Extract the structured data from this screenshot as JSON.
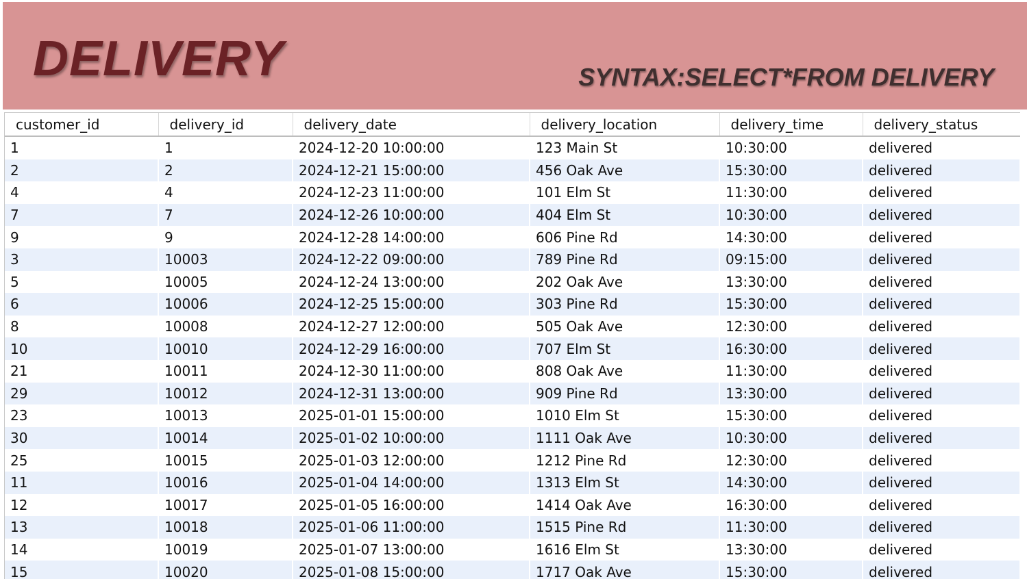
{
  "header": {
    "title": "DELIVERY",
    "syntax": "SYNTAX:SELECT*FROM DELIVERY"
  },
  "colors": {
    "banner": "#d89494",
    "title": "#6b2226",
    "row_stripe": "#e9f0fb"
  },
  "table": {
    "columns": [
      "customer_id",
      "delivery_id",
      "delivery_date",
      "delivery_location",
      "delivery_time",
      "delivery_status"
    ],
    "rows": [
      [
        "1",
        "1",
        "2024-12-20 10:00:00",
        "123 Main St",
        "10:30:00",
        "delivered"
      ],
      [
        "2",
        "2",
        "2024-12-21 15:00:00",
        "456 Oak Ave",
        "15:30:00",
        "delivered"
      ],
      [
        "4",
        "4",
        "2024-12-23 11:00:00",
        "101 Elm St",
        "11:30:00",
        "delivered"
      ],
      [
        "7",
        "7",
        "2024-12-26 10:00:00",
        "404 Elm St",
        "10:30:00",
        "delivered"
      ],
      [
        "9",
        "9",
        "2024-12-28 14:00:00",
        "606 Pine Rd",
        "14:30:00",
        "delivered"
      ],
      [
        "3",
        "10003",
        "2024-12-22 09:00:00",
        "789 Pine Rd",
        "09:15:00",
        "delivered"
      ],
      [
        "5",
        "10005",
        "2024-12-24 13:00:00",
        "202 Oak Ave",
        "13:30:00",
        "delivered"
      ],
      [
        "6",
        "10006",
        "2024-12-25 15:00:00",
        "303 Pine Rd",
        "15:30:00",
        "delivered"
      ],
      [
        "8",
        "10008",
        "2024-12-27 12:00:00",
        "505 Oak Ave",
        "12:30:00",
        "delivered"
      ],
      [
        "10",
        "10010",
        "2024-12-29 16:00:00",
        "707 Elm St",
        "16:30:00",
        "delivered"
      ],
      [
        "21",
        "10011",
        "2024-12-30 11:00:00",
        "808 Oak Ave",
        "11:30:00",
        "delivered"
      ],
      [
        "29",
        "10012",
        "2024-12-31 13:00:00",
        "909 Pine Rd",
        "13:30:00",
        "delivered"
      ],
      [
        "23",
        "10013",
        "2025-01-01 15:00:00",
        "1010 Elm St",
        "15:30:00",
        "delivered"
      ],
      [
        "30",
        "10014",
        "2025-01-02 10:00:00",
        "1111 Oak Ave",
        "10:30:00",
        "delivered"
      ],
      [
        "25",
        "10015",
        "2025-01-03 12:00:00",
        "1212 Pine Rd",
        "12:30:00",
        "delivered"
      ],
      [
        "11",
        "10016",
        "2025-01-04 14:00:00",
        "1313 Elm St",
        "14:30:00",
        "delivered"
      ],
      [
        "12",
        "10017",
        "2025-01-05 16:00:00",
        "1414 Oak Ave",
        "16:30:00",
        "delivered"
      ],
      [
        "13",
        "10018",
        "2025-01-06 11:00:00",
        "1515 Pine Rd",
        "11:30:00",
        "delivered"
      ],
      [
        "14",
        "10019",
        "2025-01-07 13:00:00",
        "1616 Elm St",
        "13:30:00",
        "delivered"
      ],
      [
        "15",
        "10020",
        "2025-01-08 15:00:00",
        "1717 Oak Ave",
        "15:30:00",
        "delivered"
      ]
    ]
  }
}
